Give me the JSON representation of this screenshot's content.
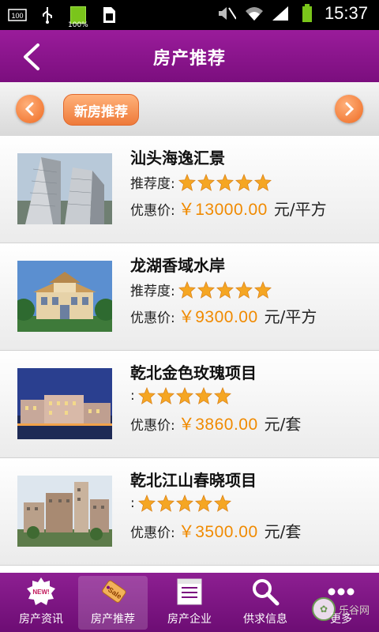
{
  "status_bar": {
    "left_icons": [
      "notification-100-icon",
      "usb-icon",
      "battery-full-icon",
      "sim-icon"
    ],
    "battery_percent": "100%",
    "time": "15:37",
    "right_icons": [
      "mute-icon",
      "wifi-icon",
      "signal-icon",
      "battery-icon"
    ]
  },
  "header": {
    "title": "房产推荐",
    "back_icon": "back-arrow-icon"
  },
  "category": {
    "active_label": "新房推荐",
    "prev_icon": "chevron-left-icon",
    "next_icon": "chevron-right-icon"
  },
  "listings": [
    {
      "name": "汕头海逸汇景",
      "rating_label": "推荐度:",
      "stars": 5,
      "price_label": "优惠价:",
      "price": "￥13000.00",
      "unit": "元/平方"
    },
    {
      "name": "龙湖香域水岸",
      "rating_label": "推荐度:",
      "stars": 5,
      "price_label": "优惠价:",
      "price": "￥9300.00",
      "unit": "元/平方"
    },
    {
      "name": "乾北金色玫瑰项目",
      "rating_label": ":",
      "stars": 5,
      "price_label": "优惠价:",
      "price": "￥3860.00",
      "unit": "元/套"
    },
    {
      "name": "乾北江山春晓项目",
      "rating_label": ":",
      "stars": 5,
      "price_label": "优惠价:",
      "price": "￥3500.00",
      "unit": "元/套"
    }
  ],
  "tabs": [
    {
      "label": "房产资讯",
      "icon": "new-badge-icon"
    },
    {
      "label": "房产推荐",
      "icon": "sale-tag-icon"
    },
    {
      "label": "房产企业",
      "icon": "document-icon"
    },
    {
      "label": "供求信息",
      "icon": "search-icon"
    },
    {
      "label": "更多",
      "icon": "more-dots-icon"
    }
  ],
  "watermark": {
    "text": "乐谷网"
  },
  "colors": {
    "primary": "#8a1a8d",
    "accent": "#f08a00",
    "star": "#f5a623"
  }
}
